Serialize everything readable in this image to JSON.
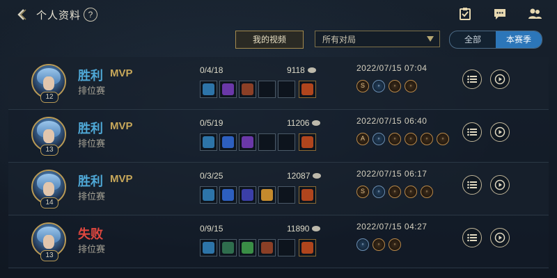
{
  "header": {
    "title": "个人资料",
    "help_label": "?"
  },
  "filters": {
    "video_button": "我的视频",
    "game_select_value": "所有对局",
    "season_toggle": [
      "全部",
      "本赛季"
    ],
    "season_active_index": 1
  },
  "matches": [
    {
      "result": "胜利",
      "outcome": "win",
      "mvp": "MVP",
      "mode": "排位赛",
      "level": "12",
      "kda": "0/4/18",
      "gold": "9118",
      "date": "2022/07/15 07:04",
      "items": [
        "#2d74a8",
        "#6a38a8",
        "#8b3f26",
        "",
        "",
        "#b0451d"
      ],
      "badges": [
        "S",
        "◦",
        "◦",
        "◦"
      ]
    },
    {
      "result": "胜利",
      "outcome": "win",
      "mvp": "MVP",
      "mode": "排位赛",
      "level": "13",
      "kda": "0/5/19",
      "gold": "11206",
      "date": "2022/07/15 06:40",
      "items": [
        "#2d74a8",
        "#2d5fbf",
        "#6a38a8",
        "",
        "",
        "#b0451d"
      ],
      "badges": [
        "A",
        "◦",
        "◦",
        "◦",
        "◦",
        "◦"
      ]
    },
    {
      "result": "胜利",
      "outcome": "win",
      "mvp": "MVP",
      "mode": "排位赛",
      "level": "14",
      "kda": "0/3/25",
      "gold": "12087",
      "date": "2022/07/15 06:17",
      "items": [
        "#2d74a8",
        "#2d5fbf",
        "#3b3fa8",
        "#c48a2d",
        "",
        "#b0451d"
      ],
      "badges": [
        "S",
        "◦",
        "◦",
        "◦",
        "◦"
      ]
    },
    {
      "result": "失败",
      "outcome": "loss",
      "mvp": "",
      "mode": "排位赛",
      "level": "13",
      "kda": "0/9/15",
      "gold": "11890",
      "date": "2022/07/15 04:27",
      "items": [
        "#2d74a8",
        "#2f6d4d",
        "#3a8e46",
        "#8b3f26",
        "",
        "#b0451d"
      ],
      "badges": [
        "◦",
        "◦",
        "◦"
      ]
    }
  ],
  "colors": {
    "win": "#4fa8d6",
    "loss": "#e0473f",
    "mvp": "#c8a85a",
    "toggle_active": "#2c76b9"
  },
  "icons": {
    "back": "chevron-left-icon",
    "top_right": [
      "task-icon",
      "chat-icon",
      "friends-icon"
    ],
    "row_actions": [
      "list-icon",
      "play-icon"
    ]
  }
}
